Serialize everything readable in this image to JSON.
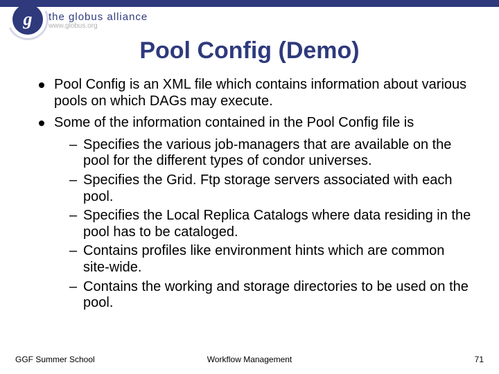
{
  "logo": {
    "letter": "g",
    "line1": "the globus alliance",
    "line2": "www.globus.org"
  },
  "title": "Pool Config (Demo)",
  "bullets": [
    {
      "text": "Pool Config is an XML file which contains information about various pools on which DAGs may execute."
    },
    {
      "text": "Some of the information contained in the Pool Config file is",
      "sub": [
        "Specifies the various job-managers that are available on the pool for the different types of condor universes.",
        "Specifies the Grid. Ftp storage servers associated with each pool.",
        "Specifies the Local Replica Catalogs where data residing in the pool has to be cataloged.",
        "Contains profiles like environment hints which are common site-wide.",
        "Contains the working and storage directories to be used on the pool."
      ]
    }
  ],
  "footer": {
    "left": "GGF Summer School",
    "center": "Workflow Management",
    "right": "71"
  }
}
